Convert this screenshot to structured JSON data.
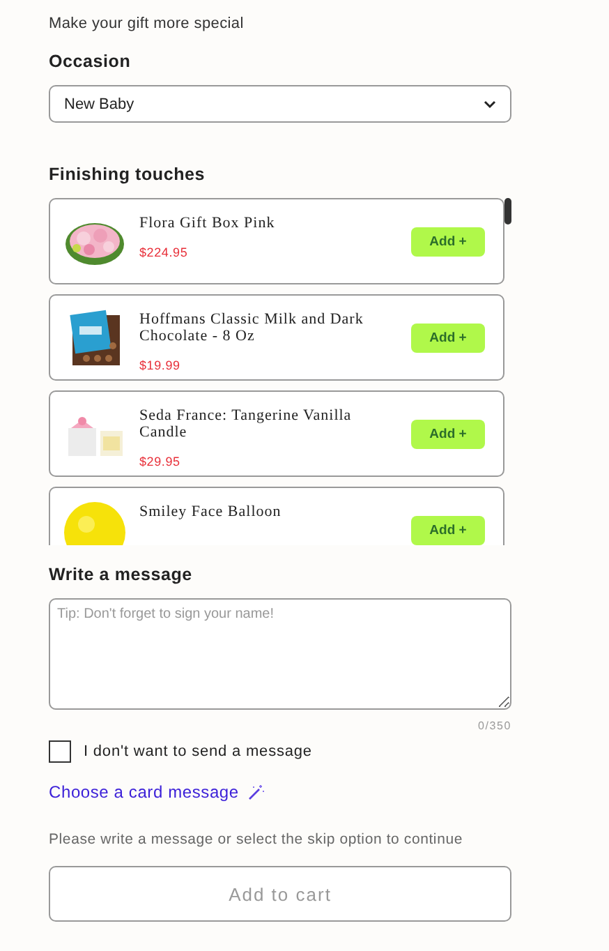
{
  "intro": "Make your gift more special",
  "occasion": {
    "label": "Occasion",
    "value": "New Baby"
  },
  "finishing": {
    "title": "Finishing touches",
    "items": [
      {
        "name": "Flora Gift Box Pink",
        "price": "$224.95",
        "button": "Add +",
        "kind": "flowers"
      },
      {
        "name": "Hoffmans Classic Milk and Dark Chocolate - 8 Oz",
        "price": "$19.99",
        "button": "Add +",
        "kind": "chocolate"
      },
      {
        "name": "Seda France: Tangerine Vanilla Candle",
        "price": "$29.95",
        "button": "Add +",
        "kind": "candle"
      },
      {
        "name": "Smiley Face Balloon",
        "button": "Add +",
        "kind": "balloon"
      }
    ]
  },
  "message": {
    "title": "Write a message",
    "placeholder": "Tip: Don't forget to sign your name!",
    "counter": "0/350",
    "skip": {
      "label": "I don't want to send a message",
      "checked": false
    },
    "link": "Choose a card message",
    "note": "Please write a message or select the skip option to continue"
  },
  "cart_button": {
    "label": "Add to cart",
    "disabled": true
  }
}
